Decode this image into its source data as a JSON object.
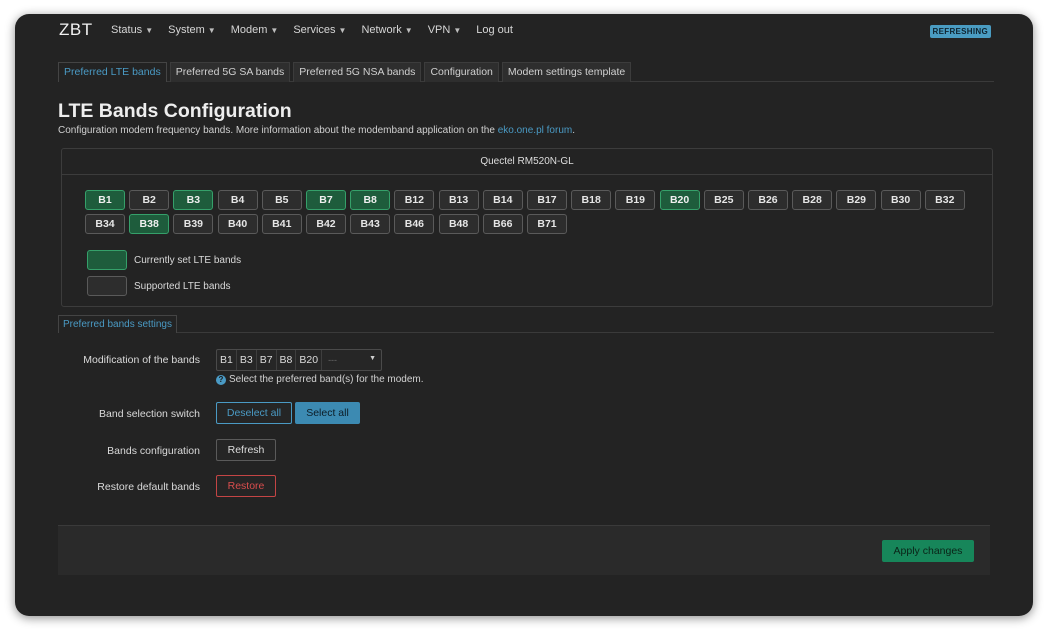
{
  "header": {
    "brand": "ZBT",
    "status_badge": "REFRESHING",
    "menu": [
      {
        "label": "Status",
        "dropdown": true
      },
      {
        "label": "System",
        "dropdown": true
      },
      {
        "label": "Modem",
        "dropdown": true
      },
      {
        "label": "Services",
        "dropdown": true
      },
      {
        "label": "Network",
        "dropdown": true
      },
      {
        "label": "VPN",
        "dropdown": true
      },
      {
        "label": "Log out",
        "dropdown": false
      }
    ]
  },
  "tabs": [
    {
      "label": "Preferred LTE bands",
      "active": true
    },
    {
      "label": "Preferred 5G SA bands",
      "active": false
    },
    {
      "label": "Preferred 5G NSA bands",
      "active": false
    },
    {
      "label": "Configuration",
      "active": false
    },
    {
      "label": "Modem settings template",
      "active": false
    }
  ],
  "page": {
    "title": "LTE Bands Configuration",
    "description": "Configuration modem frequency bands. More information about the modemband application on the ",
    "description_link": "eko.one.pl forum",
    "description_end": "."
  },
  "modem_panel": {
    "title": "Quectel RM520N-GL",
    "bands": [
      {
        "label": "B1",
        "active": true
      },
      {
        "label": "B2",
        "active": false
      },
      {
        "label": "B3",
        "active": true
      },
      {
        "label": "B4",
        "active": false
      },
      {
        "label": "B5",
        "active": false
      },
      {
        "label": "B7",
        "active": true
      },
      {
        "label": "B8",
        "active": true
      },
      {
        "label": "B12",
        "active": false
      },
      {
        "label": "B13",
        "active": false
      },
      {
        "label": "B14",
        "active": false
      },
      {
        "label": "B17",
        "active": false
      },
      {
        "label": "B18",
        "active": false
      },
      {
        "label": "B19",
        "active": false
      },
      {
        "label": "B20",
        "active": true
      },
      {
        "label": "B25",
        "active": false
      },
      {
        "label": "B26",
        "active": false
      },
      {
        "label": "B28",
        "active": false
      },
      {
        "label": "B29",
        "active": false
      },
      {
        "label": "B30",
        "active": false
      },
      {
        "label": "B32",
        "active": false
      },
      {
        "label": "B34",
        "active": false
      },
      {
        "label": "B38",
        "active": true
      },
      {
        "label": "B39",
        "active": false
      },
      {
        "label": "B40",
        "active": false
      },
      {
        "label": "B41",
        "active": false
      },
      {
        "label": "B42",
        "active": false
      },
      {
        "label": "B43",
        "active": false
      },
      {
        "label": "B46",
        "active": false
      },
      {
        "label": "B48",
        "active": false
      },
      {
        "label": "B66",
        "active": false
      },
      {
        "label": "B71",
        "active": false
      }
    ],
    "legend_current": "Currently set LTE bands",
    "legend_supported": "Supported LTE bands"
  },
  "settings": {
    "tab": "Preferred bands settings",
    "modification_label": "Modification of the bands",
    "selected_bands": [
      "B1",
      "B3",
      "B7",
      "B8",
      "B20"
    ],
    "more_indicator": "---",
    "hint": "Select the preferred band(s) for the modem.",
    "switch_label": "Band selection switch",
    "deselect_all": "Deselect all",
    "select_all": "Select all",
    "config_label": "Bands configuration",
    "refresh": "Refresh",
    "restore_label": "Restore default bands",
    "restore": "Restore"
  },
  "footer": {
    "apply": "Apply changes"
  },
  "colors": {
    "accent": "#4a9ac4",
    "active_band": "#1e5c3c",
    "active_band_border": "#35a06a",
    "danger": "#c44545",
    "apply": "#17865a"
  }
}
